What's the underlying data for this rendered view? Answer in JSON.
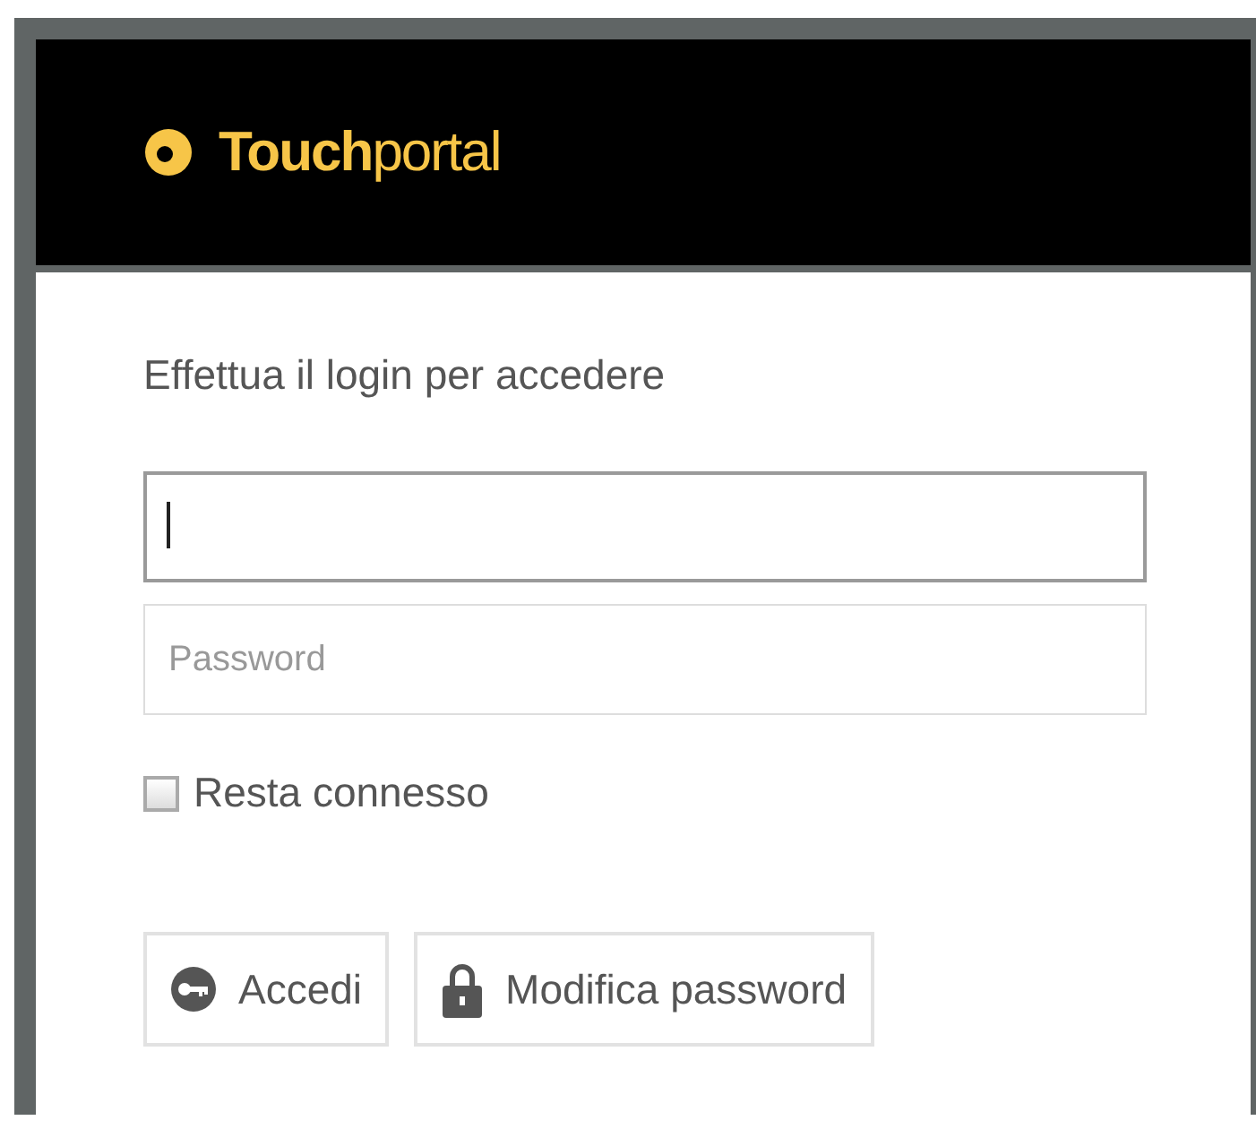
{
  "header": {
    "logo": "**Touch**portal"
  },
  "login": {
    "prompt": "Effettua il login per accedere",
    "username": {
      "focused": true
    },
    "password": {
      "placeholder": "Password"
    },
    "remember": {
      "label": "Resta connesso",
      "checked": false
    },
    "buttons": [
      {
        "label": "Accedi",
        "kind": "key"
      },
      {
        "label": "Modifica password",
        "kind": "lock"
      }
    ]
  }
}
